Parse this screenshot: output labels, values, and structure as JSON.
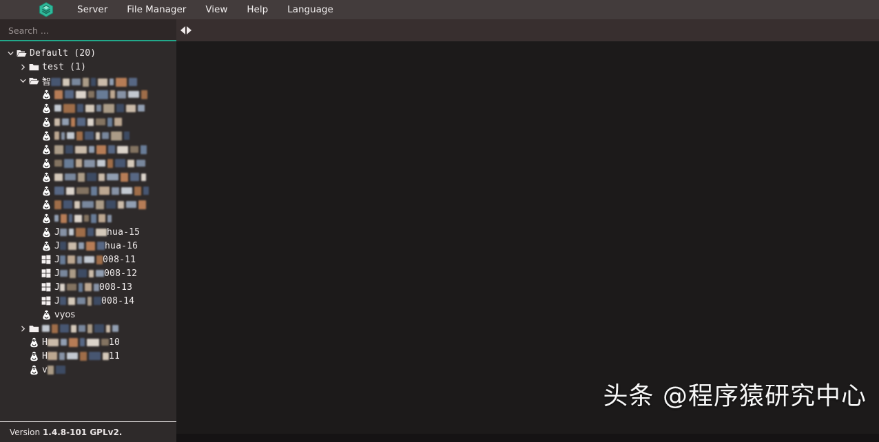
{
  "app": {
    "logo_icon": "layers-hexagon-icon",
    "accent_color": "#22a98b",
    "sidebar_bg": "#2e2a2a",
    "content_bg": "#1c1a1a",
    "menubar_bg": "#433c3c"
  },
  "menubar": {
    "items": [
      {
        "label": "Server",
        "name": "menu-server"
      },
      {
        "label": "File Manager",
        "name": "menu-file-manager"
      },
      {
        "label": "View",
        "name": "menu-view"
      },
      {
        "label": "Help",
        "name": "menu-help"
      },
      {
        "label": "Language",
        "name": "menu-language"
      }
    ]
  },
  "search": {
    "placeholder": "Search ...",
    "value": ""
  },
  "pane_toggle": {
    "left_icon": "triangle-left-icon",
    "right_icon": "triangle-right-icon"
  },
  "tree": {
    "items": [
      {
        "name": "tree-node-default",
        "indent": 0,
        "expander": "chevron-down-icon",
        "icon": "folder-open-icon",
        "label": "Default (20)",
        "redacted": []
      },
      {
        "name": "tree-node-test",
        "indent": 1,
        "expander": "chevron-right-icon",
        "icon": "folder-closed-icon",
        "label": "test (1)",
        "redacted": []
      },
      {
        "name": "tree-node-zhi",
        "indent": 1,
        "expander": "chevron-down-icon",
        "icon": "folder-open-icon",
        "label": "智",
        "redacted": [
          14,
          10,
          13,
          9,
          7,
          14,
          6,
          16,
          12
        ]
      },
      {
        "name": "tree-node-vm-1",
        "indent": 2,
        "expander": "none",
        "icon": "linux-penguin-icon",
        "label": "",
        "redacted": [
          12,
          13,
          15,
          9,
          17,
          7,
          13,
          16,
          9
        ]
      },
      {
        "name": "tree-node-vm-2",
        "indent": 2,
        "expander": "none",
        "icon": "linux-penguin-icon",
        "label": "",
        "redacted": [
          10,
          17,
          9,
          13,
          7,
          16,
          11,
          14,
          10
        ]
      },
      {
        "name": "tree-node-vm-3",
        "indent": 2,
        "expander": "none",
        "icon": "linux-penguin-icon",
        "label": "",
        "redacted": [
          8,
          10,
          6,
          12,
          9,
          14,
          7,
          11
        ]
      },
      {
        "name": "tree-node-vm-4",
        "indent": 2,
        "expander": "none",
        "icon": "linux-penguin-icon",
        "label": "",
        "redacted": [
          7,
          5,
          11,
          9,
          13,
          6,
          10,
          16,
          8
        ]
      },
      {
        "name": "tree-node-vm-5",
        "indent": 2,
        "expander": "none",
        "icon": "linux-penguin-icon",
        "label": "",
        "redacted": [
          13,
          11,
          17,
          8,
          14,
          10,
          16,
          12,
          9
        ]
      },
      {
        "name": "tree-node-vm-6",
        "indent": 2,
        "expander": "none",
        "icon": "linux-penguin-icon",
        "label": "",
        "redacted": [
          11,
          14,
          9,
          16,
          12,
          8,
          15,
          10,
          13
        ]
      },
      {
        "name": "tree-node-vm-7",
        "indent": 2,
        "expander": "none",
        "icon": "linux-penguin-icon",
        "label": "",
        "redacted": [
          12,
          16,
          10,
          14,
          9,
          17,
          11,
          13,
          7
        ]
      },
      {
        "name": "tree-node-vm-8",
        "indent": 2,
        "expander": "none",
        "icon": "linux-penguin-icon",
        "label": "",
        "redacted": [
          14,
          12,
          18,
          9,
          15,
          11,
          16,
          10,
          8
        ]
      },
      {
        "name": "tree-node-vm-9",
        "indent": 2,
        "expander": "none",
        "icon": "linux-penguin-icon",
        "label": "",
        "redacted": [
          10,
          13,
          8,
          17,
          12,
          14,
          9,
          15,
          11
        ]
      },
      {
        "name": "tree-node-vm-10",
        "indent": 2,
        "expander": "none",
        "icon": "linux-penguin-icon",
        "label": "",
        "redacted": [
          6,
          9,
          5,
          11,
          7,
          8,
          10,
          6
        ]
      },
      {
        "name": "tree-node-vm-hua15",
        "indent": 2,
        "expander": "none",
        "icon": "linux-penguin-icon",
        "label_prefix": "J",
        "redacted": [
          10,
          7,
          14,
          9,
          16
        ],
        "label_suffix": "hua-15"
      },
      {
        "name": "tree-node-vm-hua16",
        "indent": 2,
        "expander": "none",
        "icon": "linux-penguin-icon",
        "label_prefix": "J",
        "redacted": [
          9,
          12,
          8,
          13,
          11
        ],
        "label_suffix": "hua-16"
      },
      {
        "name": "tree-node-vm-2008-11",
        "indent": 2,
        "expander": "none",
        "icon": "windows-icon",
        "label_prefix": "J",
        "redacted": [
          8,
          11,
          7,
          15,
          9
        ],
        "label_suffix": "008-11"
      },
      {
        "name": "tree-node-vm-2008-12",
        "indent": 2,
        "expander": "none",
        "icon": "windows-icon",
        "label_prefix": "J",
        "redacted": [
          11,
          9,
          13,
          7,
          12
        ],
        "label_suffix": "008-12"
      },
      {
        "name": "tree-node-vm-2008-13",
        "indent": 2,
        "expander": "none",
        "icon": "windows-icon",
        "label_prefix": "J",
        "redacted": [
          7,
          14,
          6,
          10,
          8
        ],
        "label_suffix": "008-13"
      },
      {
        "name": "tree-node-vm-2008-14",
        "indent": 2,
        "expander": "none",
        "icon": "windows-icon",
        "label_prefix": "J",
        "redacted": [
          9,
          10,
          12,
          6,
          11
        ],
        "label_suffix": "008-14"
      },
      {
        "name": "tree-node-vm-vyos",
        "indent": 2,
        "expander": "none",
        "icon": "linux-penguin-icon",
        "label": "vyos",
        "redacted": []
      },
      {
        "name": "tree-node-folder-2",
        "indent": 1,
        "expander": "chevron-right-icon",
        "icon": "folder-closed-icon",
        "label": "",
        "redacted": [
          11,
          9,
          13,
          8,
          10,
          7,
          14,
          6,
          9
        ]
      },
      {
        "name": "tree-node-host-10",
        "indent": 1,
        "expander": "none",
        "icon": "linux-penguin-icon",
        "label_prefix": "H",
        "redacted": [
          16,
          9,
          13,
          7,
          18,
          11
        ],
        "label_suffix": "10"
      },
      {
        "name": "tree-node-host-11",
        "indent": 1,
        "expander": "none",
        "icon": "linux-penguin-icon",
        "label_prefix": "H",
        "redacted": [
          14,
          8,
          16,
          10,
          17,
          9
        ],
        "label_suffix": "11"
      },
      {
        "name": "tree-node-host-v",
        "indent": 1,
        "expander": "none",
        "icon": "linux-penguin-icon",
        "label_prefix": "v",
        "redacted": [
          9,
          14
        ],
        "label_suffix": ""
      }
    ]
  },
  "statusbar": {
    "prefix": "Version ",
    "version": "1.4.8-101 GPLv2."
  },
  "watermark": {
    "text": "头条 @程序猿研究中心"
  }
}
